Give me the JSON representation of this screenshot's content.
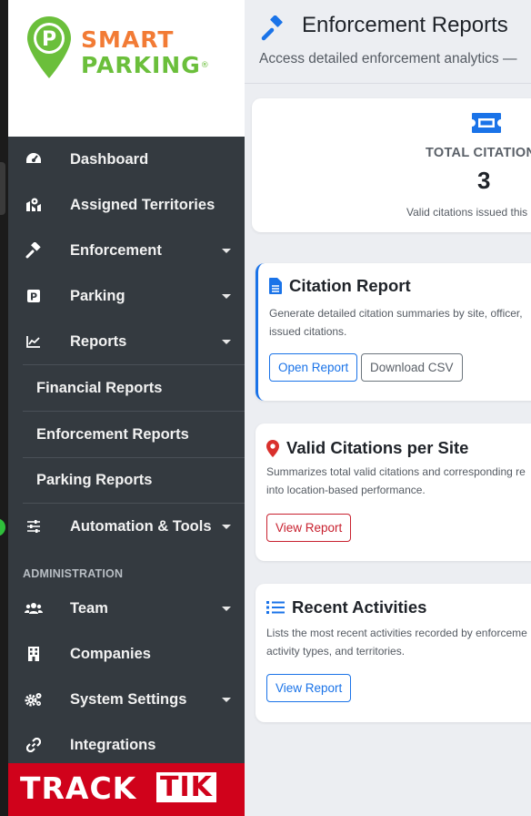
{
  "brand": {
    "logo_line1": "SMART",
    "logo_line2": "PARKING",
    "logo_mark": "®",
    "footer_logo_a": "TRACK",
    "footer_logo_b": "TIK",
    "colors": {
      "orange": "#f27b35",
      "green": "#6bbf3b",
      "tracktik_red": "#d0021b",
      "accent_blue": "#1a73e8",
      "danger_red": "#c8212f"
    }
  },
  "sidebar": {
    "items": [
      {
        "label": "Dashboard",
        "icon": "tachometer-icon",
        "has_caret": false
      },
      {
        "label": "Assigned Territories",
        "icon": "map-marked-icon",
        "has_caret": false
      },
      {
        "label": "Enforcement",
        "icon": "gavel-icon",
        "has_caret": true
      },
      {
        "label": "Parking",
        "icon": "parking-icon",
        "has_caret": true
      },
      {
        "label": "Reports",
        "icon": "chart-line-icon",
        "has_caret": true
      }
    ],
    "report_sub_items": [
      {
        "label": "Financial Reports"
      },
      {
        "label": "Enforcement Reports"
      },
      {
        "label": "Parking Reports"
      }
    ],
    "automation": {
      "label": "Automation & Tools",
      "icon": "sliders-icon",
      "has_caret": true
    },
    "admin_section_label": "ADMINISTRATION",
    "admin_items": [
      {
        "label": "Team",
        "icon": "users-icon",
        "has_caret": true
      },
      {
        "label": "Companies",
        "icon": "building-icon",
        "has_caret": false
      },
      {
        "label": "System Settings",
        "icon": "cogs-icon",
        "has_caret": true
      },
      {
        "label": "Integrations",
        "icon": "link-icon",
        "has_caret": false
      }
    ]
  },
  "header": {
    "title": "Enforcement Reports",
    "subtitle": "Access detailed enforcement analytics —"
  },
  "stat": {
    "label": "TOTAL CITATION",
    "value": "3",
    "note": "Valid citations issued this"
  },
  "reports": [
    {
      "title": "Citation Report",
      "description": "Generate detailed citation summaries by site, officer, issued citations.",
      "buttons": [
        "Open Report",
        "Download CSV"
      ]
    },
    {
      "title": "Valid Citations per Site",
      "description": "Summarizes total valid citations and corresponding re into location-based performance.",
      "buttons": [
        "View Report"
      ]
    },
    {
      "title": "Recent Activities",
      "description": "Lists the most recent activities recorded by enforceme activity types, and territories.",
      "buttons": [
        "View Report"
      ]
    }
  ]
}
